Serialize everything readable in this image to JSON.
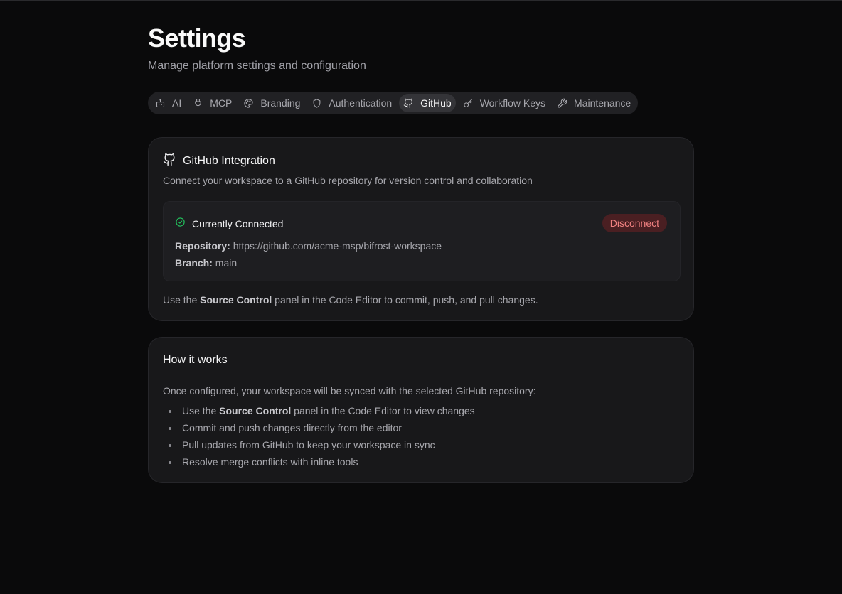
{
  "page": {
    "title": "Settings",
    "subtitle": "Manage platform settings and configuration"
  },
  "tabs": [
    {
      "label": "AI",
      "icon": "bot-icon",
      "active": false
    },
    {
      "label": "MCP",
      "icon": "plug-icon",
      "active": false
    },
    {
      "label": "Branding",
      "icon": "palette-icon",
      "active": false
    },
    {
      "label": "Authentication",
      "icon": "shield-icon",
      "active": false
    },
    {
      "label": "GitHub",
      "icon": "github-icon",
      "active": true
    },
    {
      "label": "Workflow Keys",
      "icon": "key-icon",
      "active": false
    },
    {
      "label": "Maintenance",
      "icon": "wrench-icon",
      "active": false
    }
  ],
  "github_card": {
    "icon": "github-icon",
    "title": "GitHub Integration",
    "description": "Connect your workspace to a GitHub repository for version control and collaboration",
    "status": {
      "icon": "check-circle-icon",
      "label": "Currently Connected",
      "disconnect_label": "Disconnect",
      "repository_label": "Repository:",
      "repository_value": "https://github.com/acme-msp/bifrost-workspace",
      "branch_label": "Branch:",
      "branch_value": "main"
    },
    "footer": {
      "pre": "Use the ",
      "bold": "Source Control",
      "post": " panel in the Code Editor to commit, push, and pull changes."
    }
  },
  "how_it_works": {
    "title": "How it works",
    "intro": "Once configured, your workspace will be synced with the selected GitHub repository:",
    "items": [
      {
        "pre": "Use the ",
        "bold": "Source Control",
        "post": " panel in the Code Editor to view changes"
      },
      {
        "pre": "Commit and push changes directly from the editor",
        "bold": "",
        "post": ""
      },
      {
        "pre": "Pull updates from GitHub to keep your workspace in sync",
        "bold": "",
        "post": ""
      },
      {
        "pre": "Resolve merge conflicts with inline tools",
        "bold": "",
        "post": ""
      }
    ]
  },
  "colors": {
    "background": "#0a0a0b",
    "card": "#18181a",
    "success": "#22c55e",
    "danger_text": "#f08080",
    "danger_bg": "#4a1f22"
  }
}
